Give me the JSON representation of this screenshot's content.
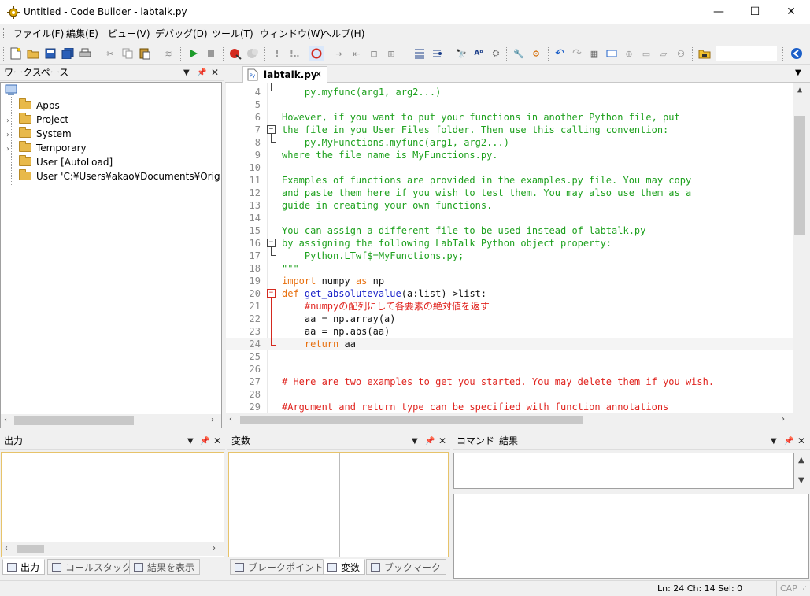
{
  "window": {
    "title": "Untitled - Code Builder - labtalk.py",
    "minimize": "—",
    "maximize": "☐",
    "close": "✕"
  },
  "menu": [
    "ファイル(F)",
    "編集(E)",
    "ビュー(V)",
    "デバッグ(D)",
    "ツール(T)",
    "ウィンドウ(W)",
    "ヘルプ(H)"
  ],
  "toolbar": {
    "search_value": ""
  },
  "workspace": {
    "title": "ワークスペース",
    "items": [
      "Apps",
      "Project",
      "System",
      "Temporary",
      "User  [AutoLoad]",
      "User 'C:¥Users¥akao¥Documents¥OriginLab¥"
    ]
  },
  "editor": {
    "tab_label": "labtalk.py",
    "lines": [
      {
        "n": "4",
        "segs": [
          {
            "t": "    py.myfunc(arg1, arg2...)",
            "c": "g"
          }
        ]
      },
      {
        "n": "5",
        "segs": []
      },
      {
        "n": "6",
        "segs": [
          {
            "t": "However, if you want to put your functions in another Python file, put",
            "c": "g"
          }
        ]
      },
      {
        "n": "7",
        "segs": [
          {
            "t": "the file in you User Files folder. Then use this calling convention:",
            "c": "g"
          }
        ]
      },
      {
        "n": "8",
        "segs": [
          {
            "t": "    py.MyFunctions.myfunc(arg1, arg2...)",
            "c": "g"
          }
        ]
      },
      {
        "n": "9",
        "segs": [
          {
            "t": "where the file name is MyFunctions.py.",
            "c": "g"
          }
        ]
      },
      {
        "n": "10",
        "segs": []
      },
      {
        "n": "11",
        "segs": [
          {
            "t": "Examples of functions are provided in the examples.py file. You may copy",
            "c": "g"
          }
        ]
      },
      {
        "n": "12",
        "segs": [
          {
            "t": "and paste them here if you wish to test them. You may also use them as a",
            "c": "g"
          }
        ]
      },
      {
        "n": "13",
        "segs": [
          {
            "t": "guide in creating your own functions.",
            "c": "g"
          }
        ]
      },
      {
        "n": "14",
        "segs": []
      },
      {
        "n": "15",
        "segs": [
          {
            "t": "You can assign a different file to be used instead of labtalk.py",
            "c": "g"
          }
        ]
      },
      {
        "n": "16",
        "segs": [
          {
            "t": "by assigning the following LabTalk Python object property:",
            "c": "g"
          }
        ]
      },
      {
        "n": "17",
        "segs": [
          {
            "t": "    Python.LTwf$=MyFunctions.py;",
            "c": "g"
          }
        ]
      },
      {
        "n": "18",
        "segs": [
          {
            "t": "\"\"\"",
            "c": "g"
          }
        ]
      },
      {
        "n": "19",
        "segs": [
          {
            "t": "import",
            "c": "o"
          },
          {
            "t": " numpy ",
            "c": "k"
          },
          {
            "t": "as",
            "c": "o"
          },
          {
            "t": " np",
            "c": "k"
          }
        ]
      },
      {
        "n": "20",
        "segs": [
          {
            "t": "def",
            "c": "o"
          },
          {
            "t": " ",
            "c": "k"
          },
          {
            "t": "get_absolutevalue",
            "c": "b"
          },
          {
            "t": "(a:list)->list:",
            "c": "k"
          }
        ]
      },
      {
        "n": "21",
        "segs": [
          {
            "t": "    #numpyの配列にして各要素の絶対値を返す",
            "c": "r"
          }
        ]
      },
      {
        "n": "22",
        "segs": [
          {
            "t": "    aa = np.array(a)",
            "c": "k"
          }
        ]
      },
      {
        "n": "23",
        "segs": [
          {
            "t": "    aa = np.abs(aa)",
            "c": "k"
          }
        ]
      },
      {
        "n": "24",
        "segs": [
          {
            "t": "    ",
            "c": "k"
          },
          {
            "t": "return",
            "c": "o"
          },
          {
            "t": " aa",
            "c": "k"
          }
        ]
      },
      {
        "n": "25",
        "segs": []
      },
      {
        "n": "26",
        "segs": []
      },
      {
        "n": "27",
        "segs": [
          {
            "t": "# Here are two examples to get you started. You may delete them if you wish.",
            "c": "r"
          }
        ]
      },
      {
        "n": "28",
        "segs": []
      },
      {
        "n": "29",
        "segs": [
          {
            "t": "#Argument and return type can be specified with function annotations",
            "c": "r"
          }
        ]
      }
    ]
  },
  "panels": {
    "output": {
      "title": "出力",
      "tabs": [
        "出力",
        "コールスタック",
        "結果を表示"
      ]
    },
    "variables": {
      "title": "変数",
      "tabs": [
        "ブレークポイント",
        "変数",
        "ブックマーク"
      ]
    },
    "command": {
      "title": "コマンド_結果"
    }
  },
  "status": {
    "position": "Ln: 24 Ch: 14 Sel: 0",
    "caps": "CAP"
  }
}
